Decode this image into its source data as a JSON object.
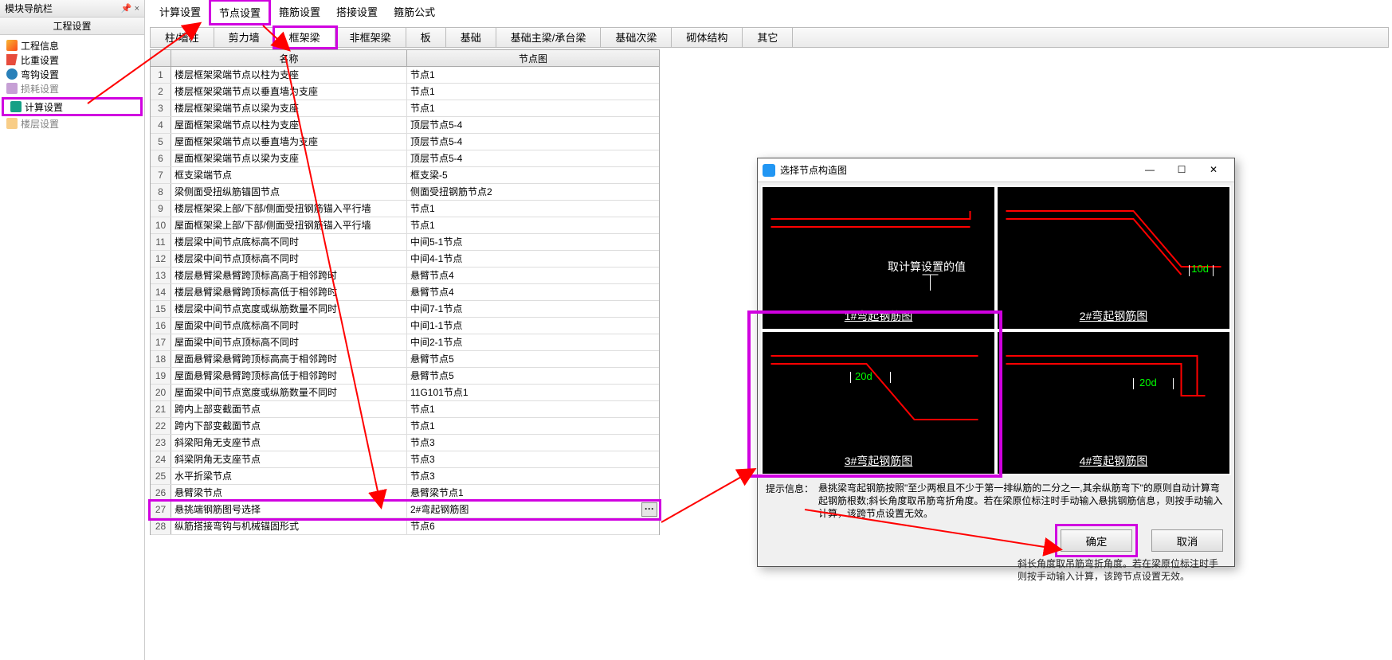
{
  "nav": {
    "panel_title": "模块导航栏",
    "section_title": "工程设置",
    "items": [
      {
        "label": "工程信息"
      },
      {
        "label": "比重设置"
      },
      {
        "label": "弯钩设置"
      },
      {
        "label": "损耗设置"
      },
      {
        "label": "计算设置"
      },
      {
        "label": "楼层设置"
      }
    ]
  },
  "top_tabs": [
    "计算设置",
    "节点设置",
    "箍筋设置",
    "搭接设置",
    "箍筋公式"
  ],
  "sub_tabs": [
    "柱/墙柱",
    "剪力墙",
    "框架梁",
    "非框架梁",
    "板",
    "基础",
    "基础主梁/承台梁",
    "基础次梁",
    "砌体结构",
    "其它"
  ],
  "table": {
    "headers": {
      "name": "名称",
      "graph": "节点图"
    },
    "rows": [
      {
        "n": 1,
        "name": "楼层框架梁端节点以柱为支座",
        "graph": "节点1"
      },
      {
        "n": 2,
        "name": "楼层框架梁端节点以垂直墙为支座",
        "graph": "节点1"
      },
      {
        "n": 3,
        "name": "楼层框架梁端节点以梁为支座",
        "graph": "节点1"
      },
      {
        "n": 4,
        "name": "屋面框架梁端节点以柱为支座",
        "graph": "顶层节点5-4"
      },
      {
        "n": 5,
        "name": "屋面框架梁端节点以垂直墙为支座",
        "graph": "顶层节点5-4"
      },
      {
        "n": 6,
        "name": "屋面框架梁端节点以梁为支座",
        "graph": "顶层节点5-4"
      },
      {
        "n": 7,
        "name": "框支梁端节点",
        "graph": "框支梁-5"
      },
      {
        "n": 8,
        "name": "梁侧面受扭纵筋锚固节点",
        "graph": "侧面受扭钢筋节点2"
      },
      {
        "n": 9,
        "name": "楼层框架梁上部/下部/侧面受扭钢筋锚入平行墙",
        "graph": "节点1"
      },
      {
        "n": 10,
        "name": "屋面框架梁上部/下部/侧面受扭钢筋锚入平行墙",
        "graph": "节点1"
      },
      {
        "n": 11,
        "name": "楼层梁中间节点底标高不同时",
        "graph": "中间5-1节点"
      },
      {
        "n": 12,
        "name": "楼层梁中间节点顶标高不同时",
        "graph": "中间4-1节点"
      },
      {
        "n": 13,
        "name": "楼层悬臂梁悬臂跨顶标高高于相邻跨时",
        "graph": "悬臂节点4"
      },
      {
        "n": 14,
        "name": "楼层悬臂梁悬臂跨顶标高低于相邻跨时",
        "graph": "悬臂节点4"
      },
      {
        "n": 15,
        "name": "楼层梁中间节点宽度或纵筋数量不同时",
        "graph": "中间7-1节点"
      },
      {
        "n": 16,
        "name": "屋面梁中间节点底标高不同时",
        "graph": "中间1-1节点"
      },
      {
        "n": 17,
        "name": "屋面梁中间节点顶标高不同时",
        "graph": "中间2-1节点"
      },
      {
        "n": 18,
        "name": "屋面悬臂梁悬臂跨顶标高高于相邻跨时",
        "graph": "悬臂节点5"
      },
      {
        "n": 19,
        "name": "屋面悬臂梁悬臂跨顶标高低于相邻跨时",
        "graph": "悬臂节点5"
      },
      {
        "n": 20,
        "name": "屋面梁中间节点宽度或纵筋数量不同时",
        "graph": "11G101节点1"
      },
      {
        "n": 21,
        "name": "跨内上部变截面节点",
        "graph": "节点1"
      },
      {
        "n": 22,
        "name": "跨内下部变截面节点",
        "graph": "节点1"
      },
      {
        "n": 23,
        "name": "斜梁阳角无支座节点",
        "graph": "节点3"
      },
      {
        "n": 24,
        "name": "斜梁阴角无支座节点",
        "graph": "节点3"
      },
      {
        "n": 25,
        "name": "水平折梁节点",
        "graph": "节点3"
      },
      {
        "n": 26,
        "name": "悬臂梁节点",
        "graph": "悬臂梁节点1"
      },
      {
        "n": 27,
        "name": "悬挑端钢筋图号选择",
        "graph": "2#弯起钢筋图"
      },
      {
        "n": 28,
        "name": "纵筋搭接弯钩与机械锚固形式",
        "graph": "节点6"
      }
    ]
  },
  "dialog": {
    "title": "选择节点构造图",
    "diagrams": [
      {
        "label": "1#弯起钢筋图",
        "note": "取计算设置的值"
      },
      {
        "label": "2#弯起钢筋图",
        "note": "10d"
      },
      {
        "label": "3#弯起钢筋图",
        "note": "20d"
      },
      {
        "label": "4#弯起钢筋图",
        "note": "20d"
      }
    ],
    "tip_label": "提示信息：",
    "tip_text": "悬挑梁弯起钢筋按照\"至少两根且不少于第一排纵筋的二分之一,其余纵筋弯下\"的原则自动计算弯起钢筋根数;斜长角度取吊筋弯折角度。若在梁原位标注时手动输入悬挑钢筋信息，则按手动输入计算，该跨节点设置无效。",
    "ok": "确定",
    "cancel": "取消"
  },
  "edge_hint": "斜长角度取吊筋弯折角度。若在梁原位标注时手\n则按手动输入计算，该跨节点设置无效。"
}
